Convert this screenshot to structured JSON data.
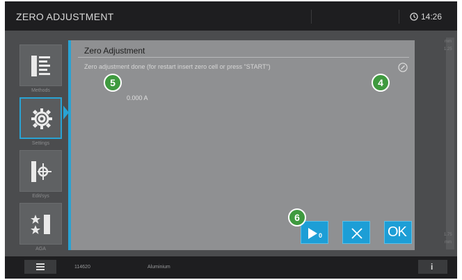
{
  "header": {
    "title": "ZERO ADJUSTMENT",
    "time": "14:26",
    "clock_icon": "clock-icon"
  },
  "sidebar": {
    "items": [
      {
        "icon": "methods-list-icon",
        "label": "Methods"
      },
      {
        "icon": "settings-gear-icon",
        "label": "Settings",
        "active": true
      },
      {
        "icon": "edit-target-icon",
        "label": "Edit/sys"
      },
      {
        "icon": "grade-stars-icon",
        "label": "AGA"
      }
    ]
  },
  "scale": {
    "top_label": "mm",
    "top_value": "1.25",
    "bottom_value": "1.75",
    "bottom_label": "mm"
  },
  "dialog": {
    "title": "Zero Adjustment",
    "message": "Zero adjustment done (for restart insert zero cell or press \"START\")",
    "measurement": "0.000 A",
    "edit_icon": "edit-circle-icon",
    "buttons": {
      "start_icon": "play-zero-icon",
      "start_subscript": "0",
      "cancel_icon": "close-icon",
      "ok_label": "OK"
    }
  },
  "callouts": [
    "5",
    "4",
    "6"
  ],
  "footer": {
    "menu_icon": "hamburger-menu-icon",
    "status_left": "114620",
    "status_material": "Aluminium",
    "info_label": "i"
  },
  "colors": {
    "accent": "#29a3d4",
    "button": "#1d9ed6",
    "callout": "#3f9a3f",
    "bar": "#1e1e20"
  }
}
